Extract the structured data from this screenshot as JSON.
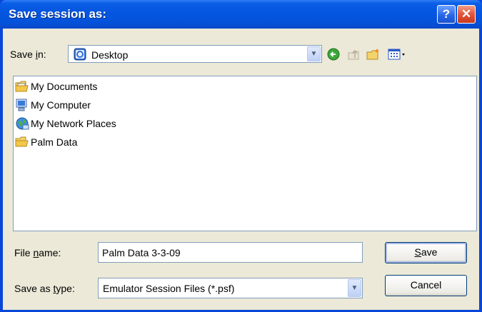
{
  "window": {
    "title": "Save session as:",
    "help_button": "?",
    "close_button": "✕"
  },
  "toolbar": {
    "save_in_label_pre": "Save ",
    "save_in_label_accel": "i",
    "save_in_label_post": "n:",
    "location_value": "Desktop",
    "icons": [
      "back-icon",
      "up-folder-icon",
      "new-folder-icon",
      "view-menu-icon"
    ]
  },
  "files": [
    {
      "name": "My Documents",
      "icon": "documents-folder-icon"
    },
    {
      "name": "My Computer",
      "icon": "computer-icon"
    },
    {
      "name": "My Network Places",
      "icon": "network-places-icon"
    },
    {
      "name": "Palm Data",
      "icon": "folder-icon"
    }
  ],
  "filename": {
    "label_pre": "File ",
    "label_accel": "n",
    "label_post": "ame:",
    "value": "Palm Data 3-3-09"
  },
  "filetype": {
    "label_pre": "Save as ",
    "label_accel": "t",
    "label_post": "ype:",
    "value": "Emulator Session Files (*.psf)"
  },
  "buttons": {
    "save_accel": "S",
    "save_rest": "ave",
    "cancel": "Cancel"
  },
  "colors": {
    "titlebar": "#0556e0",
    "dialog_bg": "#ece9d8",
    "close_red": "#e2553a"
  }
}
